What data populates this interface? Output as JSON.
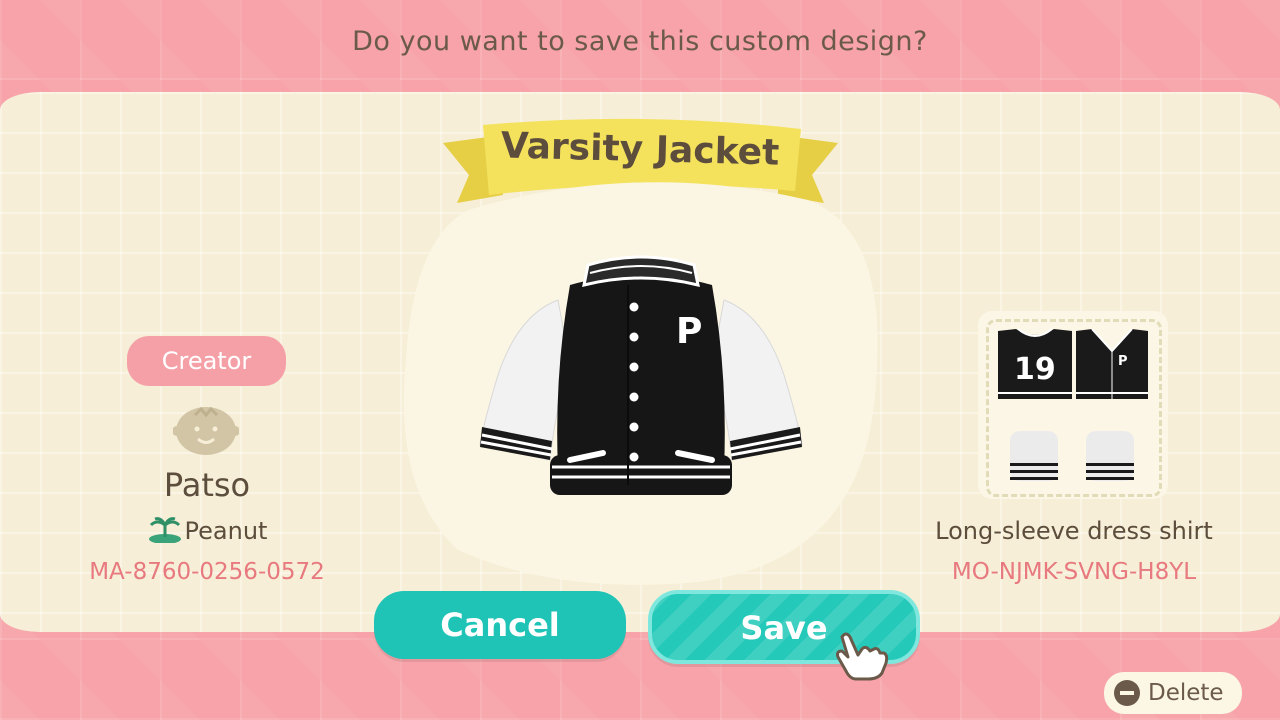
{
  "dialog": {
    "question": "Do you want to save this custom design?",
    "design_name": "Varsity Jacket"
  },
  "creator": {
    "label": "Creator",
    "name": "Patso",
    "island": "Peanut",
    "creator_id": "MA-8760-0256-0572"
  },
  "design": {
    "garment_type": "Long-sleeve dress shirt",
    "design_id": "MO-NJMK-SVNG-H8YL",
    "number": "19",
    "letter": "P"
  },
  "buttons": {
    "cancel": "Cancel",
    "save": "Save",
    "delete": "Delete"
  },
  "colors": {
    "accent": "#1fc4b6",
    "background": "#f7a3a9",
    "panel": "#f6eed6",
    "ribbon": "#f3e15a",
    "pink_text": "#e7797f"
  },
  "icons": [
    "avatar-icon",
    "island-palm-icon",
    "pointer-hand-icon",
    "minus-button-icon"
  ]
}
